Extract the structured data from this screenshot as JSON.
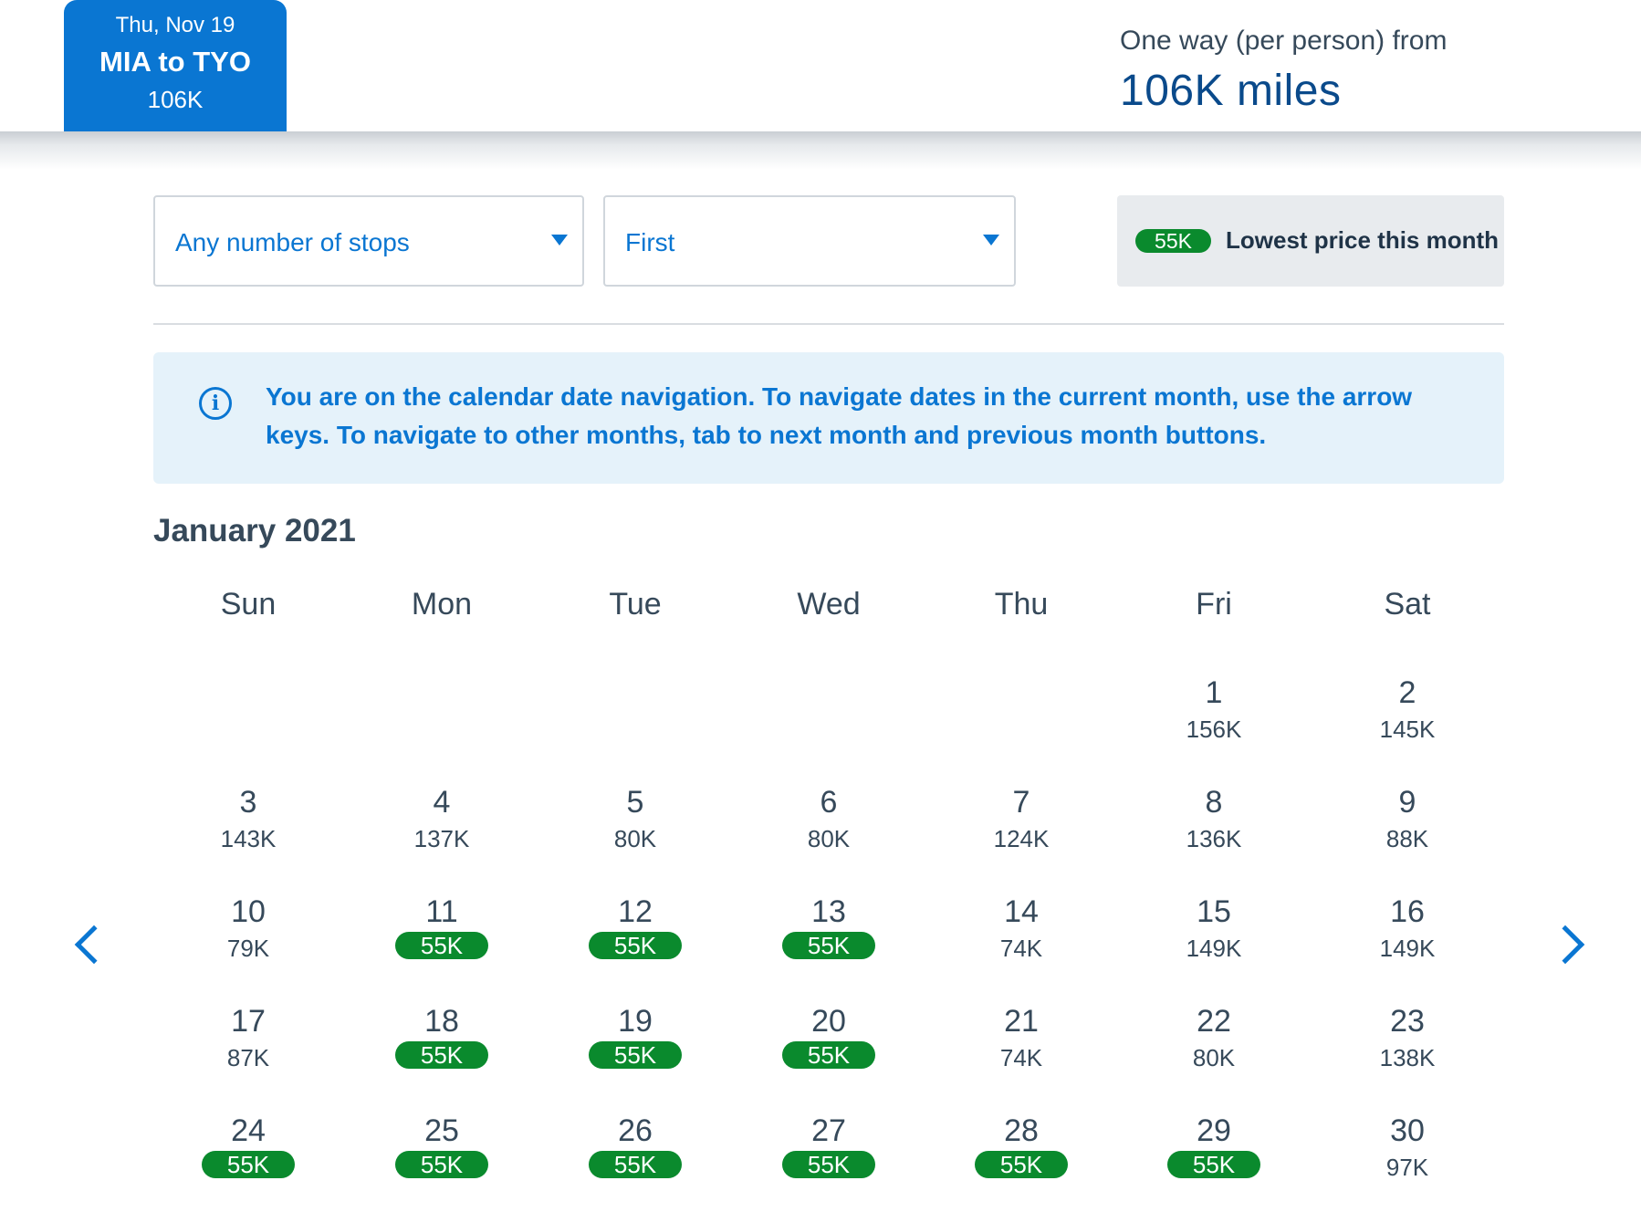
{
  "trip": {
    "date": "Thu, Nov 19",
    "route": "MIA to TYO",
    "price": "106K"
  },
  "fare": {
    "label": "One way (per person) from",
    "amount": "106K miles"
  },
  "filters": {
    "stops": "Any number of stops",
    "cabin": "First"
  },
  "legend": {
    "badge": "55K",
    "text": "Lowest price this month"
  },
  "info": {
    "text": "You are on the calendar date navigation. To navigate dates in the current month, use the arrow keys. To navigate to other months, tab to next month and previous month buttons."
  },
  "calendar": {
    "month": "January 2021",
    "weekdays": [
      "Sun",
      "Mon",
      "Tue",
      "Wed",
      "Thu",
      "Fri",
      "Sat"
    ],
    "lowest_price": "55K",
    "days": [
      {
        "day": "1",
        "price": "156K",
        "low": false
      },
      {
        "day": "2",
        "price": "145K",
        "low": false
      },
      {
        "day": "3",
        "price": "143K",
        "low": false
      },
      {
        "day": "4",
        "price": "137K",
        "low": false
      },
      {
        "day": "5",
        "price": "80K",
        "low": false
      },
      {
        "day": "6",
        "price": "80K",
        "low": false
      },
      {
        "day": "7",
        "price": "124K",
        "low": false
      },
      {
        "day": "8",
        "price": "136K",
        "low": false
      },
      {
        "day": "9",
        "price": "88K",
        "low": false
      },
      {
        "day": "10",
        "price": "79K",
        "low": false
      },
      {
        "day": "11",
        "price": "55K",
        "low": true
      },
      {
        "day": "12",
        "price": "55K",
        "low": true
      },
      {
        "day": "13",
        "price": "55K",
        "low": true
      },
      {
        "day": "14",
        "price": "74K",
        "low": false
      },
      {
        "day": "15",
        "price": "149K",
        "low": false
      },
      {
        "day": "16",
        "price": "149K",
        "low": false
      },
      {
        "day": "17",
        "price": "87K",
        "low": false
      },
      {
        "day": "18",
        "price": "55K",
        "low": true
      },
      {
        "day": "19",
        "price": "55K",
        "low": true
      },
      {
        "day": "20",
        "price": "55K",
        "low": true
      },
      {
        "day": "21",
        "price": "74K",
        "low": false
      },
      {
        "day": "22",
        "price": "80K",
        "low": false
      },
      {
        "day": "23",
        "price": "138K",
        "low": false
      },
      {
        "day": "24",
        "price": "55K",
        "low": true
      },
      {
        "day": "25",
        "price": "55K",
        "low": true
      },
      {
        "day": "26",
        "price": "55K",
        "low": true
      },
      {
        "day": "27",
        "price": "55K",
        "low": true
      },
      {
        "day": "28",
        "price": "55K",
        "low": true
      },
      {
        "day": "29",
        "price": "55K",
        "low": true
      },
      {
        "day": "30",
        "price": "97K",
        "low": false
      }
    ]
  },
  "colors": {
    "brand_blue": "#0a76d2",
    "low_price_green": "#0a8a2d",
    "info_bg": "#e5f2fa",
    "text": "#36495a"
  }
}
